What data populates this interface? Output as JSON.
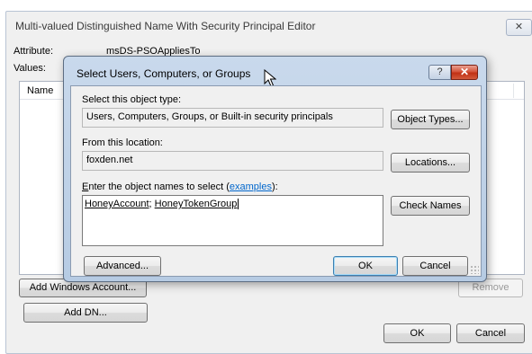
{
  "back_window": {
    "title": "Multi-valued Distinguished Name With Security Principal Editor",
    "close_glyph": "✕",
    "attribute_label": "Attribute:",
    "attribute_value": "msDS-PSOAppliesTo",
    "values_label": "Values:",
    "list_column_name": "Name",
    "add_windows_account_label": "Add Windows Account...",
    "remove_label": "Remove",
    "add_dn_label": "Add DN...",
    "ok_label": "OK",
    "cancel_label": "Cancel"
  },
  "dialog": {
    "title": "Select Users, Computers, or Groups",
    "help_glyph": "?",
    "close_glyph": "✕",
    "object_type_label": "Select this object type:",
    "object_type_value": "Users, Computers, Groups, or Built-in security principals",
    "object_types_button": "Object Types...",
    "location_label": "From this location:",
    "location_value": "foxden.net",
    "locations_button": "Locations...",
    "names_label_accel": "E",
    "names_label_rest": "nter the object names to select (",
    "names_label_link": "examples",
    "names_label_end": "):",
    "names_value_1": "HoneyAccount",
    "names_separator": "; ",
    "names_value_2": "HoneyTokenGroup",
    "check_names_button": "Check Names",
    "advanced_button": "Advanced...",
    "ok_button": "OK",
    "cancel_button": "Cancel"
  },
  "colors": {
    "dialog_frame": "#b6cbe3",
    "close_red": "#c13014",
    "link_blue": "#0066cc"
  }
}
